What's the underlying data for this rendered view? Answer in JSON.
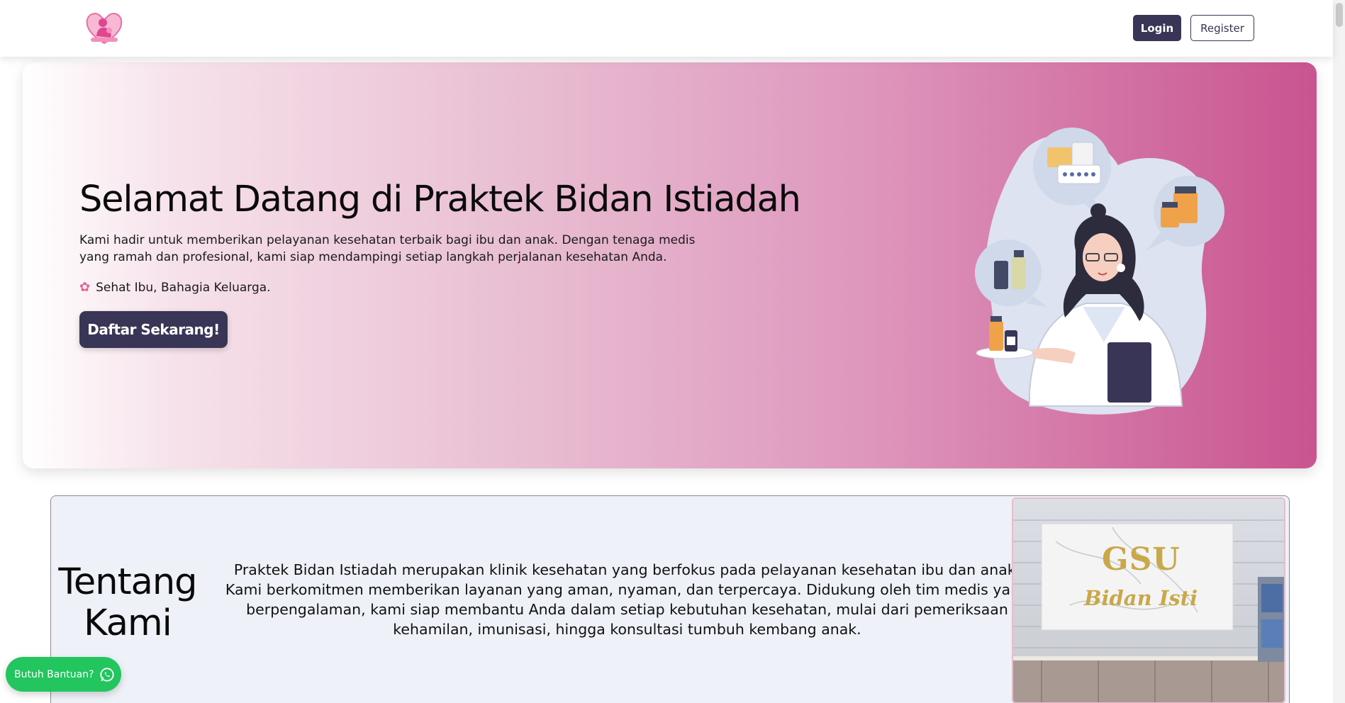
{
  "navbar": {
    "logo_icon": "mother-heart-logo-icon",
    "login_label": "Login",
    "register_label": "Register"
  },
  "hero": {
    "title": "Selamat Datang di Praktek Bidan Istiadah",
    "description": "Kami hadir untuk memberikan pelayanan kesehatan terbaik bagi ibu dan anak. Dengan tenaga medis yang ramah dan profesional, kami siap mendampingi setiap langkah perjalanan kesehatan Anda.",
    "tagline_icon": "flower-icon",
    "tagline": "Sehat Ibu, Bahagia Keluarga.",
    "cta_label": "Daftar Sekarang!",
    "illustration": "pharmacist-illustration"
  },
  "about": {
    "title": "Tentang Kami",
    "text": "Praktek Bidan Istiadah merupakan klinik kesehatan yang berfokus pada pelayanan kesehatan ibu dan anak. Kami berkomitmen memberikan layanan yang aman, nyaman, dan terpercaya. Didukung oleh tim medis yang berpengalaman, kami siap membantu Anda dalam setiap kebutuhan kesehatan, mulai dari pemeriksaan kehamilan, imunisasi, hingga konsultasi tumbuh kembang anak.",
    "photo_sign_line1": "GSU",
    "photo_sign_line2": "Bidan Isti"
  },
  "help": {
    "label": "Butuh Bantuan?",
    "icon": "whatsapp-icon"
  },
  "colors": {
    "primary": "#393556",
    "accent_pink": "#c9548f",
    "whatsapp_green": "#22c55e"
  }
}
